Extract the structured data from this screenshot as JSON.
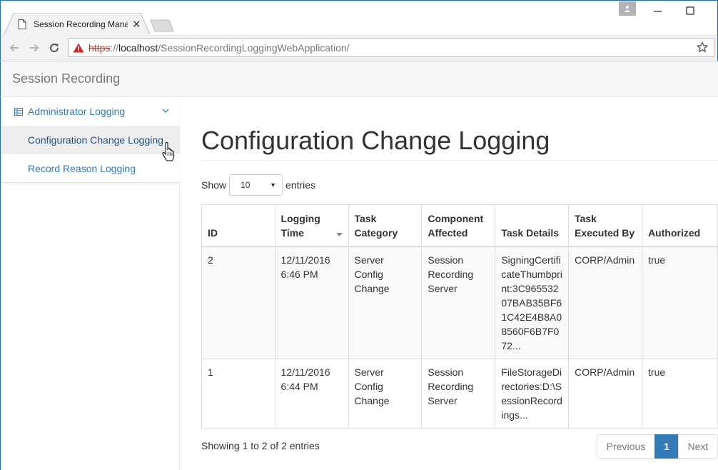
{
  "browser": {
    "tab_title": "Session Recording Mana",
    "url_scheme": "https",
    "url_sep": "://",
    "url_host": "localhost",
    "url_path": "/SessionRecordingLoggingWebApplication/"
  },
  "app": {
    "brand": "Session Recording"
  },
  "sidebar": {
    "group_label": "Administrator Logging",
    "items": [
      {
        "label": "Configuration Change Logging",
        "active": true
      },
      {
        "label": "Record Reason Logging",
        "active": false
      }
    ]
  },
  "main": {
    "title": "Configuration Change Logging",
    "show_label": "Show",
    "entries_value": "10",
    "entries_label": "entries",
    "columns": [
      "ID",
      "Logging Time",
      "Task Category",
      "Component Affected",
      "Task Details",
      "Task Executed By",
      "Authorized"
    ],
    "rows": [
      {
        "id": "2",
        "time": "12/11/2016 6:46 PM",
        "category": "Server Config Change",
        "component": "Session Recording Server",
        "details": "SigningCertificateThumbprint:3C96553207BAB35BF61C42E4B8A08560F6B7F072...",
        "executed_by": "CORP/Admin",
        "authorized": "true"
      },
      {
        "id": "1",
        "time": "12/11/2016 6:44 PM",
        "category": "Server Config Change",
        "component": "Session Recording Server",
        "details": "FileStorageDirectories:D:\\SessionRecordings...",
        "executed_by": "CORP/Admin",
        "authorized": "true"
      }
    ],
    "info": "Showing 1 to 2 of 2 entries",
    "pager": {
      "previous": "Previous",
      "current": "1",
      "next": "Next"
    }
  },
  "colors": {
    "link": "#337ab7",
    "pager_active": "#337ab7",
    "window_border": "#1e6fb8",
    "insecure": "#c0392b"
  }
}
